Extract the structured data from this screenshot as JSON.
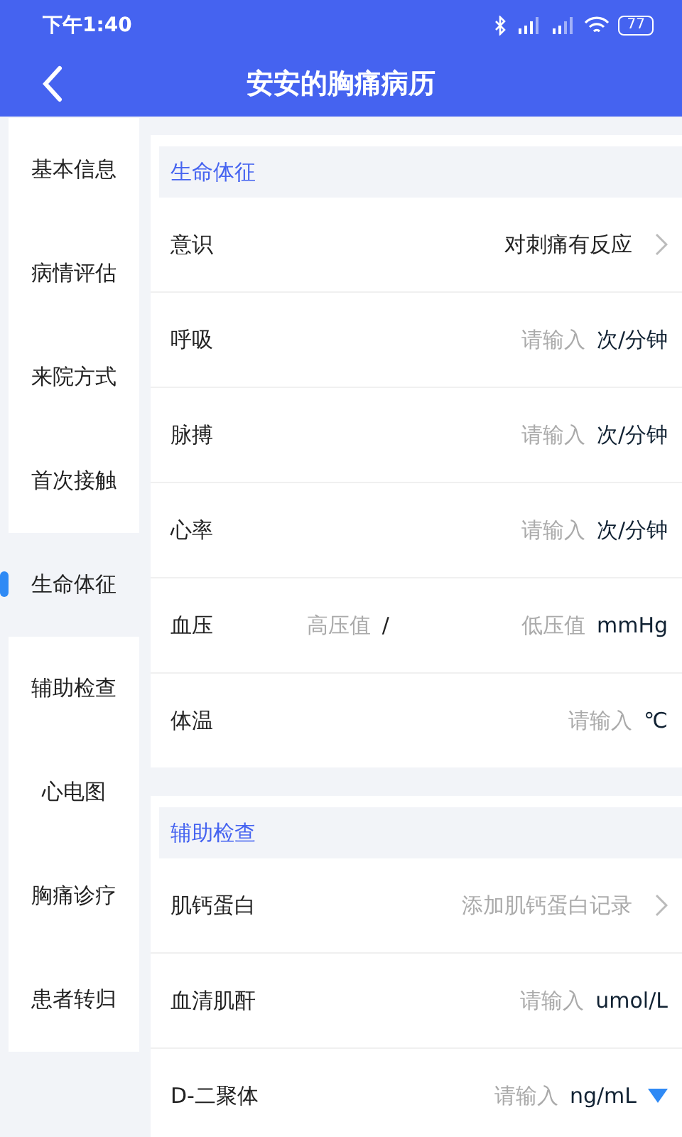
{
  "status_bar": {
    "time": "下午1:40",
    "battery": "77"
  },
  "header": {
    "title": "安安的胸痛病历"
  },
  "sidebar": {
    "items": [
      {
        "label": "基本信息",
        "selected": false
      },
      {
        "label": "病情评估",
        "selected": false
      },
      {
        "label": "来院方式",
        "selected": false
      },
      {
        "label": "首次接触",
        "selected": false
      },
      {
        "label": "生命体征",
        "selected": true
      },
      {
        "label": "辅助检查",
        "selected": false
      },
      {
        "label": "心电图",
        "selected": false
      },
      {
        "label": "胸痛诊疗",
        "selected": false
      },
      {
        "label": "患者转归",
        "selected": false
      }
    ]
  },
  "sections": [
    {
      "title": "生命体征",
      "rows": [
        {
          "kind": "select",
          "label": "意识",
          "value": "对刺痛有反应"
        },
        {
          "kind": "input",
          "label": "呼吸",
          "placeholder": "请输入",
          "unit": "次/分钟"
        },
        {
          "kind": "input",
          "label": "脉搏",
          "placeholder": "请输入",
          "unit": "次/分钟"
        },
        {
          "kind": "input",
          "label": "心率",
          "placeholder": "请输入",
          "unit": "次/分钟"
        },
        {
          "kind": "range",
          "label": "血压",
          "placeholder": "高压值",
          "separator": "/",
          "placeholder_2": "低压值",
          "unit": "mmHg"
        },
        {
          "kind": "input",
          "label": "体温",
          "placeholder": "请输入",
          "unit": "℃"
        }
      ]
    },
    {
      "title": "辅助检查",
      "rows": [
        {
          "kind": "add",
          "label": "肌钙蛋白",
          "placeholder": "添加肌钙蛋白记录"
        },
        {
          "kind": "input",
          "label": "血清肌酐",
          "placeholder": "请输入",
          "unit": "umol/L"
        },
        {
          "kind": "input",
          "label": "D-二聚体",
          "placeholder": "请输入",
          "unit": "ng/mL",
          "unit_dropdown": true
        }
      ]
    }
  ]
}
